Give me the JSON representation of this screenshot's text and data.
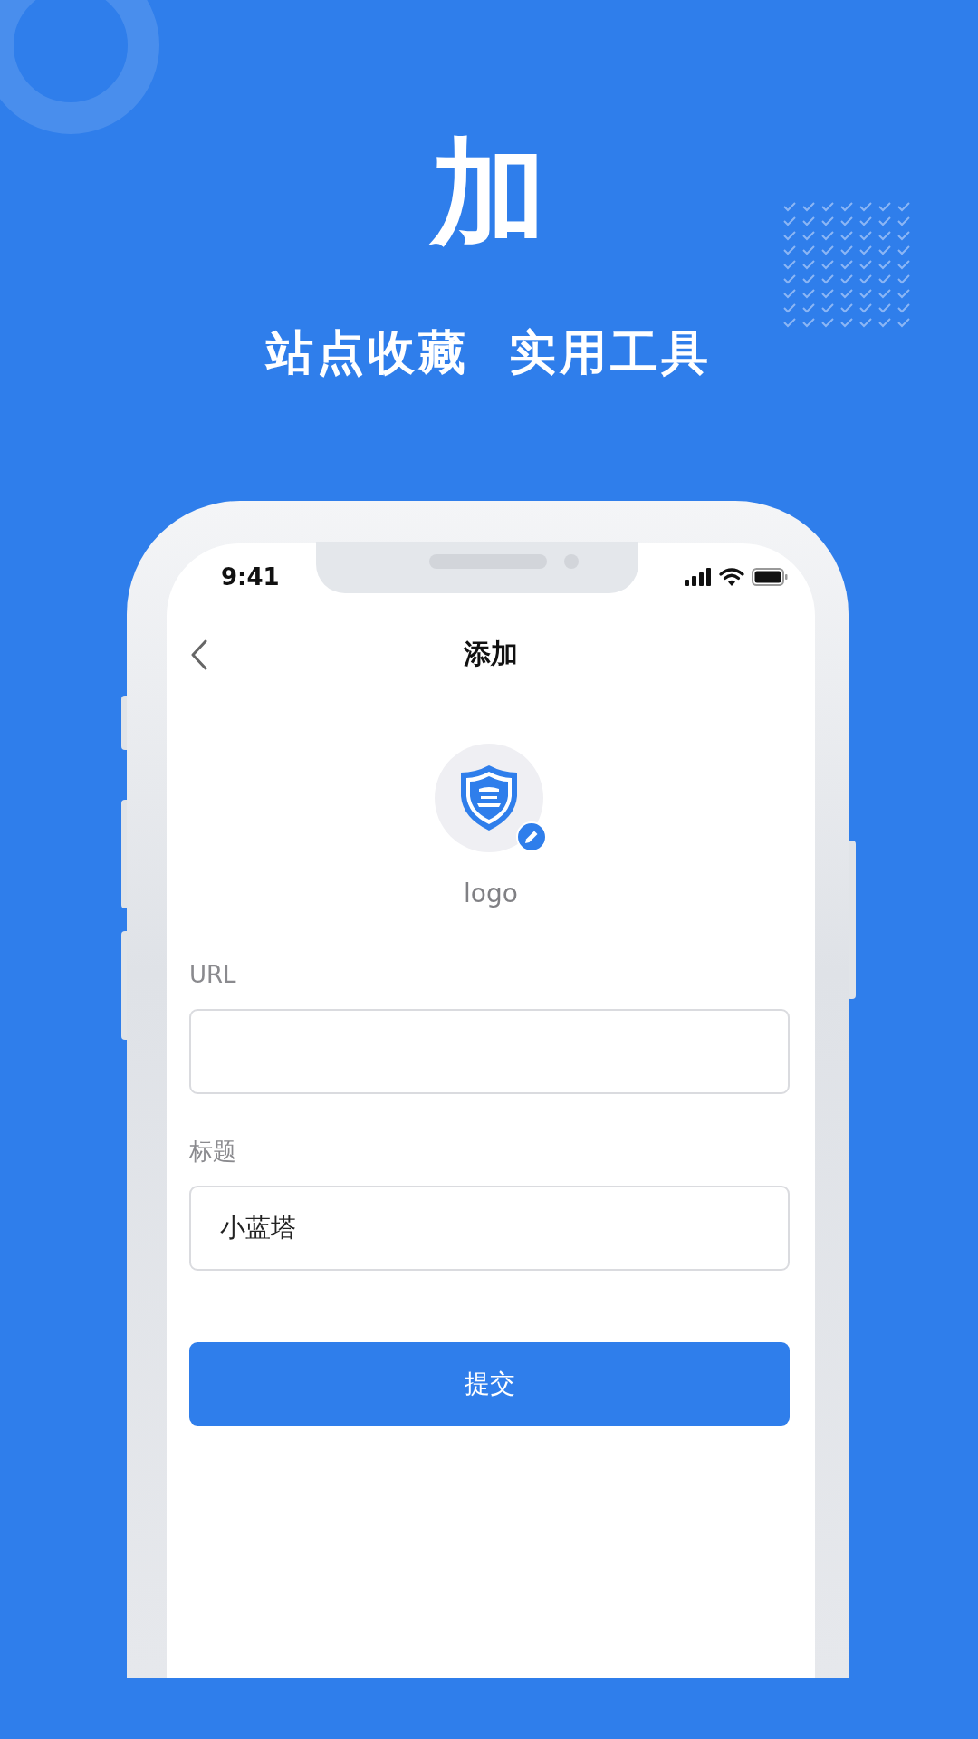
{
  "headline": "加",
  "taglines": [
    "站点收藏",
    "实用工具"
  ],
  "status_bar": {
    "time": "9:41"
  },
  "nav": {
    "title": "添加"
  },
  "logo": {
    "label": "logo"
  },
  "fields": [
    {
      "label": "URL"
    },
    {
      "label": "标题",
      "value": "小蓝塔"
    }
  ],
  "submit_button": "提交"
}
